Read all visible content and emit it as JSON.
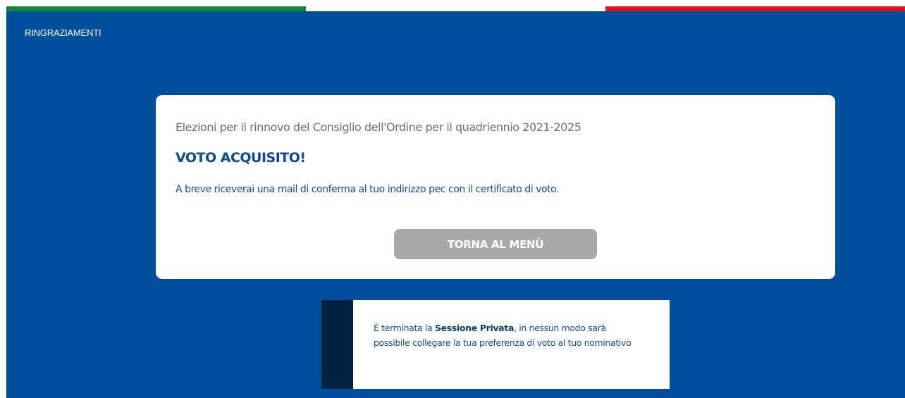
{
  "colors": {
    "flag_green": "#0f8a3b",
    "flag_white": "#ffffff",
    "flag_red": "#e3141c",
    "background_blue": "#004f9c",
    "button_gray": "#a9a9a9",
    "notice_bar": "#00223f"
  },
  "header": {
    "section_title": "RINGRAZIAMENTI"
  },
  "card": {
    "subtitle": "Elezioni per il rinnovo del Consiglio dell'Ordine per il quadriennio 2021-2025",
    "heading": "VOTO ACQUISITO!",
    "message": "A breve riceverai una mail di conferma al tuo indirizzo pec con il certificato di voto.",
    "button_label": "TORNA AL MENÙ"
  },
  "notice": {
    "text_before": "È terminata la ",
    "text_bold": "Sessione Privata",
    "text_after": ", in nessun modo sarà possibile collegare la tua preferenza di voto al tuo nominativo"
  }
}
